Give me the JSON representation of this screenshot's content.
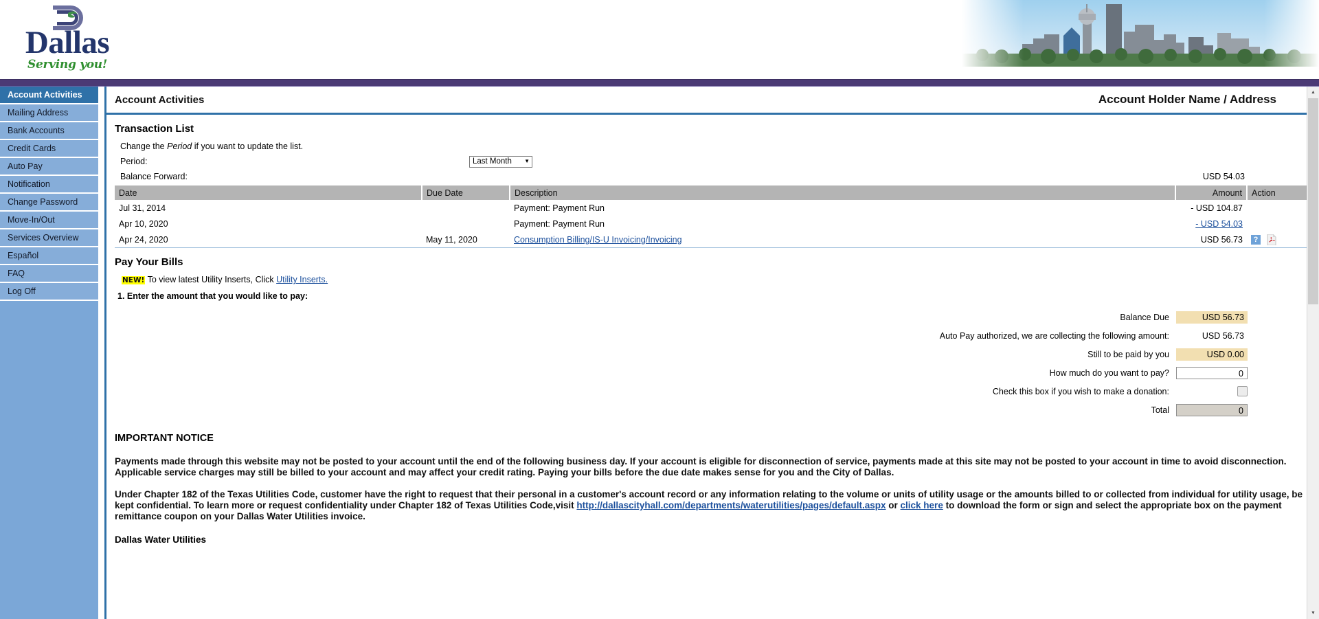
{
  "brand": {
    "name": "Dallas",
    "tagline": "Serving you!",
    "logo_icon": "dallas-d-logo",
    "banner_icon": "dallas-skyline-photo"
  },
  "sidebar": {
    "items": [
      {
        "label": "Account Activities",
        "active": true
      },
      {
        "label": "Mailing Address",
        "active": false
      },
      {
        "label": "Bank Accounts",
        "active": false
      },
      {
        "label": "Credit Cards",
        "active": false
      },
      {
        "label": "Auto Pay",
        "active": false
      },
      {
        "label": "Notification",
        "active": false
      },
      {
        "label": "Change Password",
        "active": false
      },
      {
        "label": "Move-In/Out",
        "active": false
      },
      {
        "label": "Services Overview",
        "active": false
      },
      {
        "label": "Español",
        "active": false
      },
      {
        "label": "FAQ",
        "active": false
      },
      {
        "label": "Log Off",
        "active": false
      }
    ]
  },
  "header": {
    "page_title": "Account Activities",
    "account_holder": "Account Holder Name / Address"
  },
  "transactions": {
    "heading": "Transaction List",
    "hint_prefix": "Change the ",
    "hint_italic": "Period",
    "hint_suffix": " if you want to update the list.",
    "period_label": "Period:",
    "period_value": "Last Month",
    "period_caret": "▼",
    "balance_forward_label": "Balance Forward:",
    "balance_forward_value": "USD 54.03",
    "columns": [
      "Date",
      "Due Date",
      "Description",
      "Amount",
      "Action"
    ],
    "rows": [
      {
        "date": "Jul 31, 2014",
        "due_date": "",
        "description": "Payment: Payment Run",
        "description_link": false,
        "amount": "- USD 104.87",
        "amount_link": false,
        "has_help": false,
        "has_pdf": false
      },
      {
        "date": "Apr 10, 2020",
        "due_date": "",
        "description": "Payment: Payment Run",
        "description_link": false,
        "amount": "- USD 54.03",
        "amount_link": true,
        "has_help": false,
        "has_pdf": false
      },
      {
        "date": "Apr 24, 2020",
        "due_date": "May 11, 2020",
        "description": "Consumption Billing/IS-U Invoicing/Invoicing",
        "description_link": true,
        "amount": "USD 56.73",
        "amount_link": false,
        "has_help": true,
        "has_pdf": true
      }
    ]
  },
  "pay_bills": {
    "heading": "Pay Your Bills",
    "new_badge": "NEW!",
    "inserts_text": "To view latest Utility Inserts, Click ",
    "inserts_link": "Utility Inserts.",
    "step1": "1. Enter the amount that you would like to pay:",
    "fields": [
      {
        "label": "Balance Due",
        "value": "USD 56.73",
        "style": "tan"
      },
      {
        "label": "Auto Pay authorized, we are collecting the following amount:",
        "value": "USD 56.73",
        "style": "plain"
      },
      {
        "label": "Still to be paid by you",
        "value": "USD 0.00",
        "style": "tan"
      },
      {
        "label": "How much do you want to pay?",
        "value": "0",
        "style": "input"
      },
      {
        "label": "Check this box if you wish to make a donation:",
        "value": "",
        "style": "checkbox"
      },
      {
        "label": "Total",
        "value": "0",
        "style": "total"
      }
    ]
  },
  "notice": {
    "heading": "IMPORTANT NOTICE",
    "para1": "Payments made through this website may not be posted to your account until the end of the following business day. If your account is eligible for disconnection of service, payments made at this site may not be posted to your account in time to avoid disconnection. Applicable service charges may still be billed to your account and may affect your credit rating. Paying your bills before the due date makes sense for you and the City of Dallas.",
    "para2_a": "Under Chapter 182 of the Texas Utilities Code, customer have the right to request that their personal in a customer's account record or any information relating to the volume or units of utility usage or the amounts billed to or collected from individual for utility usage, be kept confidential. To learn more or request confidentiality under Chapter 182 of Texas Utilities Code,visit ",
    "para2_url": "http://dallascityhall.com/departments/waterutilities/pages/default.aspx",
    "para2_or": " or ",
    "para2_click": "click here",
    "para2_b": " to download the form or sign and select the appropriate box on the payment remittance coupon on your Dallas Water Utilities invoice.",
    "footer": "Dallas Water Utilities"
  },
  "colors": {
    "sidebar_bg": "#86add9",
    "sidebar_active": "#2f71a8",
    "purple_bar": "#4b3a75",
    "accent_rule": "#2f71a8",
    "table_header": "#b4b4b4",
    "highlight_tan": "#f2dfb1",
    "link": "#1b4f9c"
  }
}
